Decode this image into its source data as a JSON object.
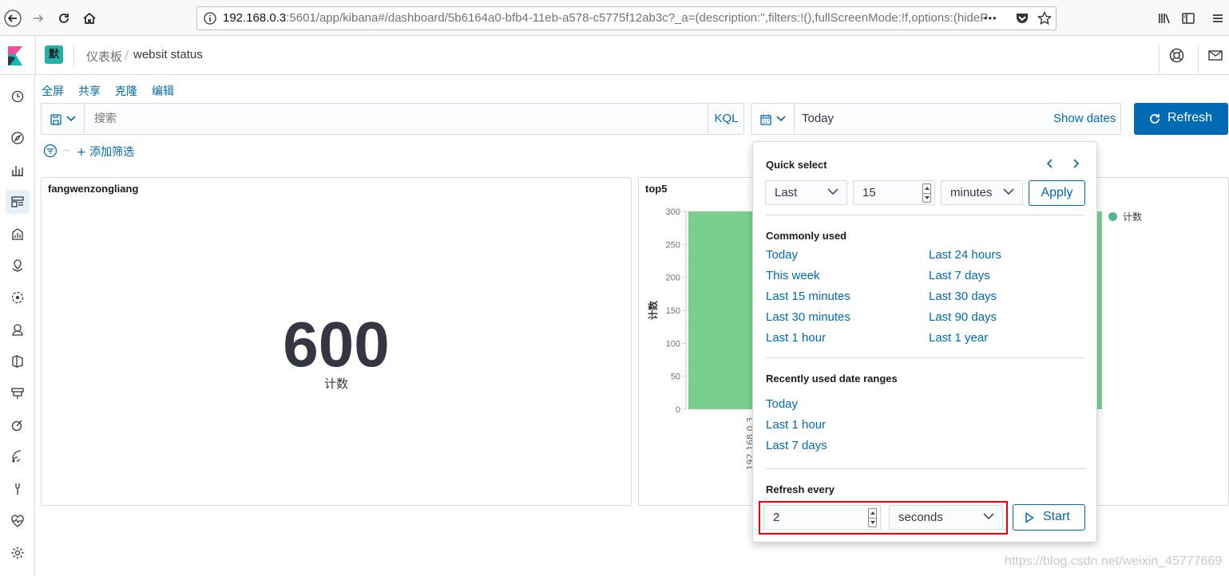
{
  "browser": {
    "url_host": "192.168.0.3",
    "url_rest": ":5601/app/kibana#/dashboard/5b6164a0-bfb4-11eb-a578-c5775f12ab3c?_a=(description:'',filters:!(),fullScreenMode:!f,options:(hideP",
    "more": "•••"
  },
  "header": {
    "space_avatar": "默",
    "breadcrumb_parent": "仪表板",
    "breadcrumb_sep": "/",
    "breadcrumb_current": "websit status"
  },
  "top_menu": [
    "全屏",
    "共享",
    "克隆",
    "编辑"
  ],
  "query": {
    "placeholder": "搜索",
    "language": "KQL",
    "date_value": "Today",
    "show_dates": "Show dates",
    "refresh": "Refresh",
    "add_filter": "+ 添加筛选"
  },
  "panels": {
    "metric": {
      "title": "fangwenzongliang",
      "value": "600",
      "label": "计数"
    },
    "chart": {
      "title": "top5",
      "legend_item": "计数",
      "x_tick_partial": "192.168.0.3"
    }
  },
  "chart_data": {
    "type": "bar",
    "title": "top5",
    "ylabel": "计数",
    "yticks": [
      "300",
      "250",
      "200",
      "150",
      "100",
      "50",
      "0"
    ],
    "ylim": [
      0,
      300
    ],
    "categories": [
      "192.168.0.3"
    ],
    "series": [
      {
        "name": "计数",
        "values": [
          300
        ]
      }
    ],
    "legend_position": "top-right",
    "color": "#7acf8f"
  },
  "popover": {
    "quick_select_title": "Quick select",
    "tense": "Last",
    "amount": "15",
    "unit": "minutes",
    "apply": "Apply",
    "commonly_used_title": "Commonly used",
    "commonly_used_left": [
      "Today",
      "This week",
      "Last 15 minutes",
      "Last 30 minutes",
      "Last 1 hour"
    ],
    "commonly_used_right": [
      "Last 24 hours",
      "Last 7 days",
      "Last 30 days",
      "Last 90 days",
      "Last 1 year"
    ],
    "recent_title": "Recently used date ranges",
    "recent": [
      "Today",
      "Last 1 hour",
      "Last 7 days"
    ],
    "refresh_title": "Refresh every",
    "refresh_amount": "2",
    "refresh_unit": "seconds",
    "start": "Start"
  },
  "watermark": "https://blog.csdn.net/weixin_45777669",
  "colors": {
    "accent": "#006bb4",
    "bar": "#7acf8f",
    "highlight": "#e7000b",
    "space_avatar": "#20b2a5"
  }
}
